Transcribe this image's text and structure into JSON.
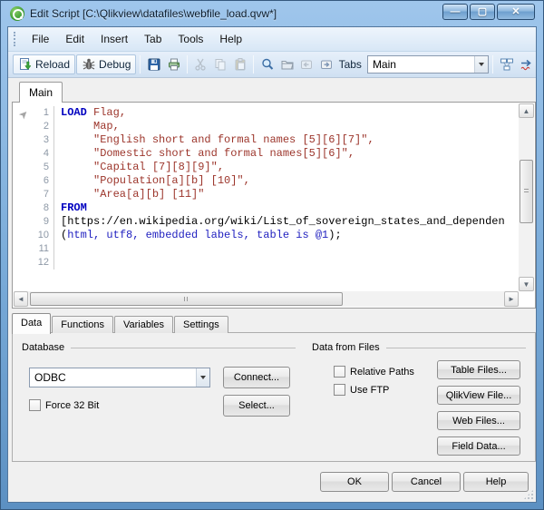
{
  "window": {
    "title": "Edit Script [C:\\Qlikview\\datafiles\\webfile_load.qvw*]",
    "minimize_glyph": "—",
    "maximize_glyph": "▢",
    "close_glyph": "✕"
  },
  "colors": {
    "frame_blue": "#78aad8",
    "keyword_blue": "#0000c0",
    "field_red": "#9c352b",
    "dialog_gray": "#f0f0f0"
  },
  "menu": {
    "items": [
      "File",
      "Edit",
      "Insert",
      "Tab",
      "Tools",
      "Help"
    ]
  },
  "toolbar": {
    "reload_label": "Reload",
    "debug_label": "Debug",
    "tabs_label": "Tabs",
    "tab_selector_value": "Main",
    "icons": [
      "reload-document-icon",
      "debug-bug-icon",
      "save-icon",
      "print-icon",
      "cut-icon",
      "copy-icon",
      "paste-icon",
      "find-icon",
      "folder-icon",
      "back-icon",
      "forward-icon",
      "table-viewer-icon",
      "syntax-check-icon"
    ]
  },
  "editor": {
    "tab_label": "Main",
    "lines": [
      {
        "num": "1",
        "segments": [
          {
            "cls": "kw",
            "text": "LOAD"
          },
          {
            "cls": "fld",
            "text": " Flag,"
          }
        ]
      },
      {
        "num": "2",
        "segments": [
          {
            "cls": "fld",
            "text": "     Map,"
          }
        ]
      },
      {
        "num": "3",
        "segments": [
          {
            "cls": "fld",
            "text": "     \"English short and formal names [5][6][7]\","
          }
        ]
      },
      {
        "num": "4",
        "segments": [
          {
            "cls": "fld",
            "text": "     \"Domestic short and formal names[5][6]\","
          }
        ]
      },
      {
        "num": "5",
        "segments": [
          {
            "cls": "fld",
            "text": "     \"Capital [7][8][9]\","
          }
        ]
      },
      {
        "num": "6",
        "segments": [
          {
            "cls": "fld",
            "text": "     \"Population[a][b] [10]\","
          }
        ]
      },
      {
        "num": "7",
        "segments": [
          {
            "cls": "fld",
            "text": "     \"Area[a][b] [11]\""
          }
        ]
      },
      {
        "num": "8",
        "segments": [
          {
            "cls": "kw",
            "text": "FROM"
          }
        ]
      },
      {
        "num": "9",
        "segments": [
          {
            "cls": "pln",
            "text": "[https://en.wikipedia.org/wiki/List_of_sovereign_states_and_dependen"
          }
        ]
      },
      {
        "num": "10",
        "segments": [
          {
            "cls": "pln",
            "text": "("
          },
          {
            "cls": "kw2",
            "text": "html, utf8, embedded labels, table is @1"
          },
          {
            "cls": "pln",
            "text": ");"
          }
        ]
      },
      {
        "num": "11",
        "segments": []
      },
      {
        "num": "12",
        "segments": []
      }
    ]
  },
  "bottom_tabs": {
    "tabs": [
      "Data",
      "Functions",
      "Variables",
      "Settings"
    ],
    "active": "Data"
  },
  "database_group": {
    "caption": "Database",
    "combo_value": "ODBC",
    "connect_button": "Connect...",
    "force32_label": "Force 32 Bit",
    "select_button": "Select..."
  },
  "files_group": {
    "caption": "Data from Files",
    "relative_paths_label": "Relative Paths",
    "use_ftp_label": "Use FTP",
    "buttons": [
      "Table Files...",
      "QlikView File...",
      "Web Files...",
      "Field Data..."
    ]
  },
  "footer": {
    "ok": "OK",
    "cancel": "Cancel",
    "help": "Help"
  }
}
